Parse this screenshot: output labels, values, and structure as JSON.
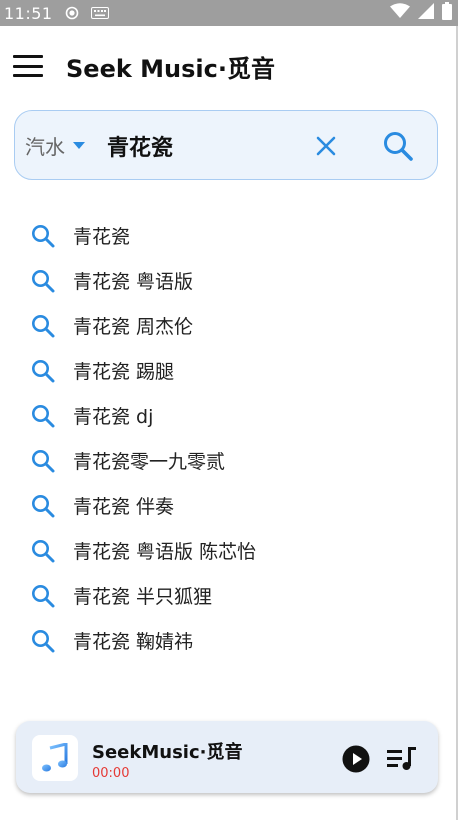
{
  "status_bar": {
    "time": "11:51",
    "icons": [
      "record-icon",
      "keyboard-icon",
      "wifi-icon",
      "signal-icon",
      "battery-icon"
    ]
  },
  "app_bar": {
    "menu_icon": "hamburger-menu-icon",
    "title": "Seek Music·觅音"
  },
  "search": {
    "source": "汽水",
    "query": "青花瓷",
    "clear_icon": "close-icon",
    "search_icon": "search-icon"
  },
  "suggestions": [
    "青花瓷",
    "青花瓷 粤语版",
    "青花瓷 周杰伦",
    "青花瓷 踢腿",
    "青花瓷 dj",
    "青花瓷零一九零贰",
    "青花瓷 伴奏",
    "青花瓷 粤语版 陈芯怡",
    "青花瓷 半只狐狸",
    "青花瓷 鞠婧祎"
  ],
  "player": {
    "title": "SeekMusic·觅音",
    "time": "00:00",
    "cover_icon": "music-note-icon",
    "play_icon": "play-icon",
    "queue_icon": "playlist-icon"
  },
  "colors": {
    "accent": "#2a8be0",
    "search_bg": "#edf4fc",
    "player_bg": "#e7eef8",
    "time_red": "#e53935",
    "status_bar": "#9e9e9e"
  }
}
